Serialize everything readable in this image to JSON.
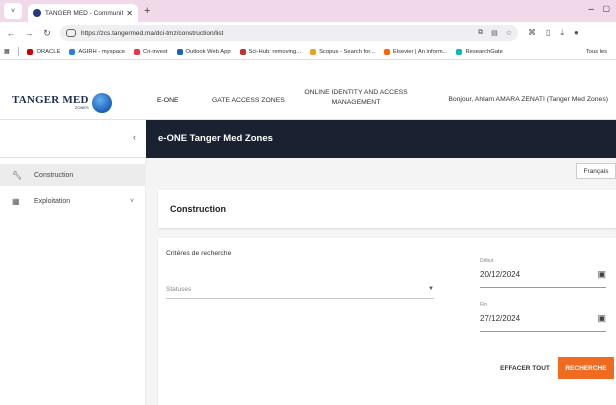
{
  "browser": {
    "tab_title": "TANGER MED - Community Sys",
    "url": "https://zcs.tangermed.ma/dci-tmz/construction/list",
    "bookmarks": [
      "ORACLE",
      "AGIRH - myspace",
      "Cri-invest",
      "Outlook Web App",
      "Sci-Hub: removing...",
      "Scopus - Search for...",
      "Elsevier | An inform...",
      "ResearchGate",
      "Tous les"
    ]
  },
  "header": {
    "logo_text": "TANGER MED",
    "logo_sub": "ZONES",
    "nav": [
      "E-ONE",
      "GATE ACCESS ZONES",
      "ONLINE IDENTITY AND ACCESS",
      "MANAGEMENT"
    ],
    "greeting": "Bonjour, Ahlam AMARA ZENATI (Tanger Med Zones)"
  },
  "title": "e-ONE Tanger Med Zones",
  "sidebar": {
    "items": [
      {
        "label": "Construction",
        "icon": "wrench-icon"
      },
      {
        "label": "Exploitation",
        "icon": "building-icon"
      }
    ]
  },
  "main": {
    "language": "Français",
    "section_title": "Construction",
    "criteria_label": "Critères de recherche",
    "status_placeholder": "Statuses",
    "start_label": "Début",
    "start_value": "20/12/2024",
    "end_label": "Fin",
    "end_value": "27/12/2024",
    "clear_button": "EFFACER TOUT",
    "search_button": "RECHERCHE"
  }
}
